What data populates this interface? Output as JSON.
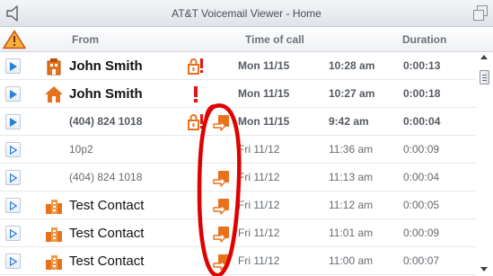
{
  "window": {
    "title": "AT&T Voicemail Viewer - Home"
  },
  "header": {
    "from": "From",
    "time_of_call": "Time of call",
    "duration": "Duration"
  },
  "icons": {
    "speaker": "speaker-icon",
    "restore": "restore-window-icon",
    "warning": "warning-triangle-icon",
    "play": "play-icon",
    "home": "home-icon",
    "office": "office-building-icon",
    "contact": "contact-building-icon",
    "lock_alert": "lock-alert-icon",
    "exclamation": "urgent-exclamation-icon",
    "forward": "forwarded-message-icon"
  },
  "colors": {
    "accent_orange": "#e8721c",
    "alert_red": "#e01414",
    "play_blue": "#2a7fd6",
    "annotation_red": "#e00000"
  },
  "messages": [
    {
      "from": "John Smith",
      "day": "Mon 11/15",
      "time": "10:28 am",
      "duration": "0:00:13",
      "style": "new-contact",
      "type_icon": "office",
      "status_icon": "lock_alert",
      "status_icon2": ""
    },
    {
      "from": "John Smith",
      "day": "Mon 11/15",
      "time": "10:27 am",
      "duration": "0:00:18",
      "style": "new-contact",
      "type_icon": "home",
      "status_icon": "exclamation",
      "status_icon2": ""
    },
    {
      "from": "(404) 824 1018",
      "day": "Mon 11/15",
      "time": "9:42 am",
      "duration": "0:00:04",
      "style": "new-number",
      "type_icon": "",
      "status_icon": "lock_alert",
      "status_icon2": "forward"
    },
    {
      "from": "10p2",
      "day": "Fri 11/12",
      "time": "11:36 am",
      "duration": "0:00:09",
      "style": "old-number",
      "type_icon": "",
      "status_icon": "",
      "status_icon2": ""
    },
    {
      "from": "(404) 824 1018",
      "day": "Fri 11/12",
      "time": "11:13 am",
      "duration": "0:00:04",
      "style": "old-number",
      "type_icon": "",
      "status_icon": "",
      "status_icon2": "forward"
    },
    {
      "from": "Test Contact",
      "day": "Fri 11/12",
      "time": "11:12 am",
      "duration": "0:00:05",
      "style": "old-contact",
      "type_icon": "contact",
      "status_icon": "",
      "status_icon2": "forward"
    },
    {
      "from": "Test Contact",
      "day": "Fri 11/12",
      "time": "11:01 am",
      "duration": "0:00:09",
      "style": "old-contact",
      "type_icon": "contact",
      "status_icon": "",
      "status_icon2": "forward"
    },
    {
      "from": "Test Contact",
      "day": "Fri 11/12",
      "time": "11:00 am",
      "duration": "0:00:07",
      "style": "old-contact",
      "type_icon": "contact",
      "status_icon": "",
      "status_icon2": "forward"
    }
  ]
}
